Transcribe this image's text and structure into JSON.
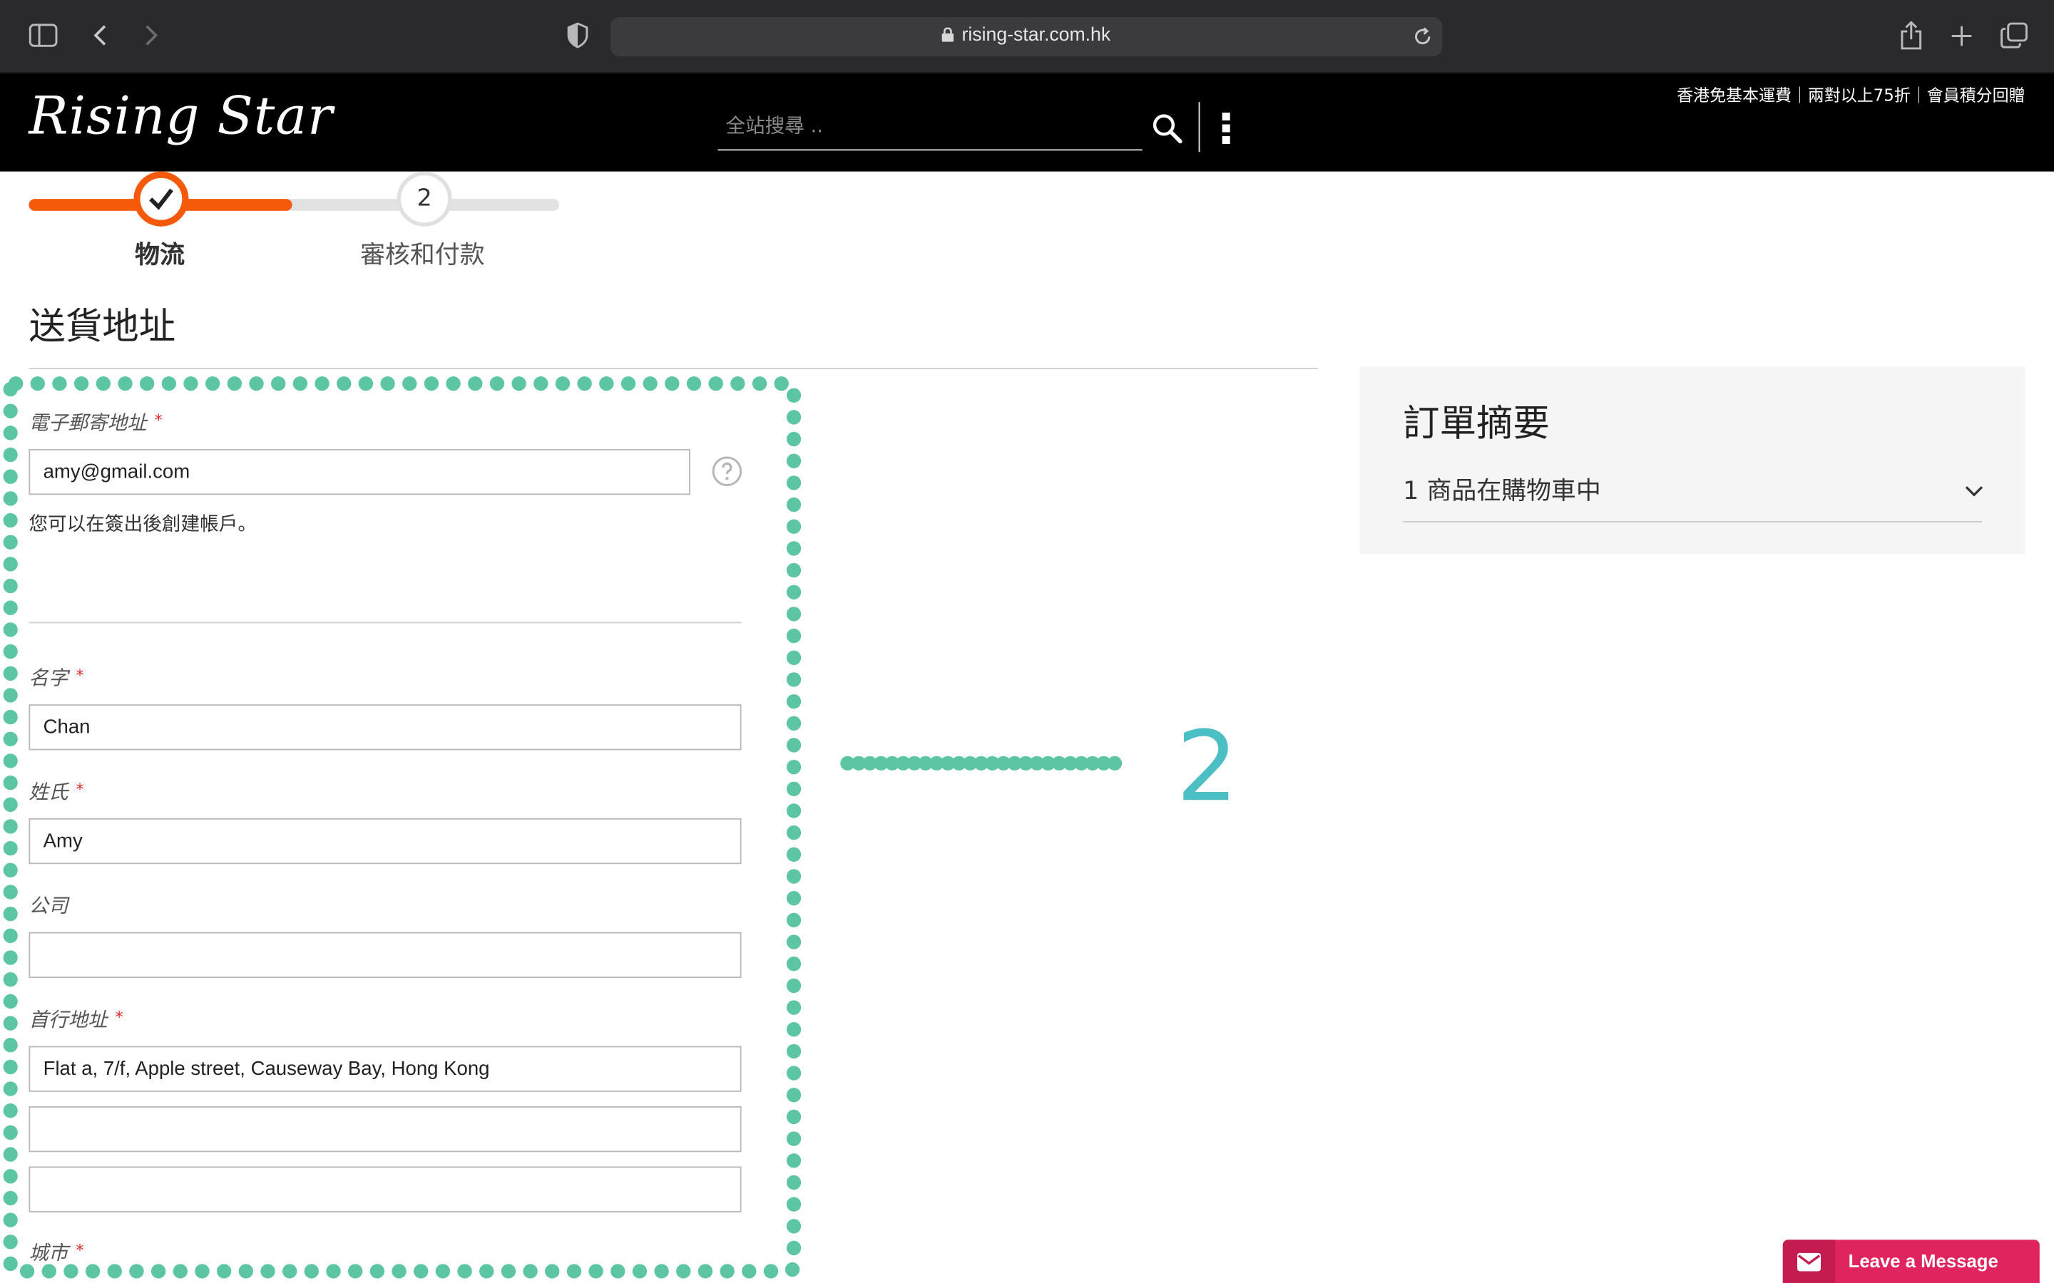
{
  "browser": {
    "url": "rising-star.com.hk"
  },
  "header": {
    "logo_text": "Rising Star",
    "search_placeholder": "全站搜尋 ..",
    "promo": "香港免基本運費｜兩對以上75折｜會員積分回贈"
  },
  "progress": {
    "steps": [
      {
        "label": "物流",
        "status": "complete"
      },
      {
        "number": "2",
        "label": "審核和付款",
        "status": "pending"
      }
    ],
    "completion_fraction": 0.5
  },
  "page": {
    "title": "送貨地址"
  },
  "form": {
    "email": {
      "label": "電子郵寄地址",
      "value": "amy@gmail.com"
    },
    "note": "您可以在簽出後創建帳戶。",
    "first_name": {
      "label": "名字",
      "value": "Chan"
    },
    "last_name": {
      "label": "姓氏",
      "value": "Amy"
    },
    "company": {
      "label": "公司",
      "value": ""
    },
    "street": {
      "label": "首行地址",
      "line1": "Flat a, 7/f, Apple street, Causeway Bay, Hong Kong",
      "line2": "",
      "line3": ""
    },
    "city": {
      "label": "城市"
    }
  },
  "annotation": {
    "number": "2",
    "color": "#5cc6a4",
    "number_color": "#4cbfc4"
  },
  "summary": {
    "title": "訂單摘要",
    "items_text": "1 商品在購物車中"
  },
  "chat": {
    "label": "Leave a Message"
  },
  "colors": {
    "accent": "#f5590a",
    "header_bg": "#000000",
    "chat": "#e0245e"
  }
}
